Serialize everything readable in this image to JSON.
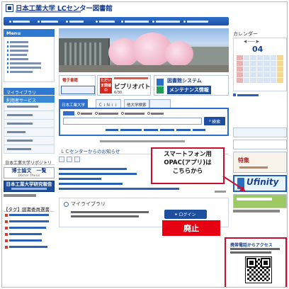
{
  "header": {
    "site_title": "日本工業大学 LCセンター図書館"
  },
  "sidebar": {
    "menu_label": "Menu",
    "mylibrary_label": "マイライブラリ",
    "services_label": "利用者サービス",
    "repository_title": "日本工業大学リポジトリ",
    "banner_white_title": "博士論文　一覧",
    "banner_white_sub": "Doctor Thesis",
    "banner_blue_title": "日本工業大学研究報告",
    "tags_heading": "【タグ】図書委員選書"
  },
  "banners": {
    "ebook_label": "電子書籍",
    "event_badge": "ただいま開催中",
    "event_title": "ビブリオバトル",
    "event_date": "6/30",
    "system_line1": "図書館システム",
    "system_line2": "メンテナンス情報"
  },
  "search": {
    "tabs": [
      "日本工業大学",
      "ＣｉＮｉｉ",
      "他大学検索"
    ],
    "button": "検索"
  },
  "news": {
    "heading": "ＬＣセンターからのお知らせ"
  },
  "mylibrary": {
    "title": "マイライブラリ",
    "login": "ログイン"
  },
  "calendar": {
    "title": "カレンダー",
    "month": "04"
  },
  "right_banners": {
    "pickup_title": "特集",
    "app_brand": "Ufinity"
  },
  "overlays": {
    "smartphone_callout": [
      "スマートフォン用",
      "OPAC(アプリ)は",
      "こちらから"
    ],
    "abolished": "廃止",
    "mobile_access": "携帯電話からアクセス"
  },
  "colors": {
    "brand_blue": "#1a3f8f",
    "nav_blue": "#2f6fcc",
    "callout_red": "#c8102e",
    "abolished_red": "#e60012"
  }
}
